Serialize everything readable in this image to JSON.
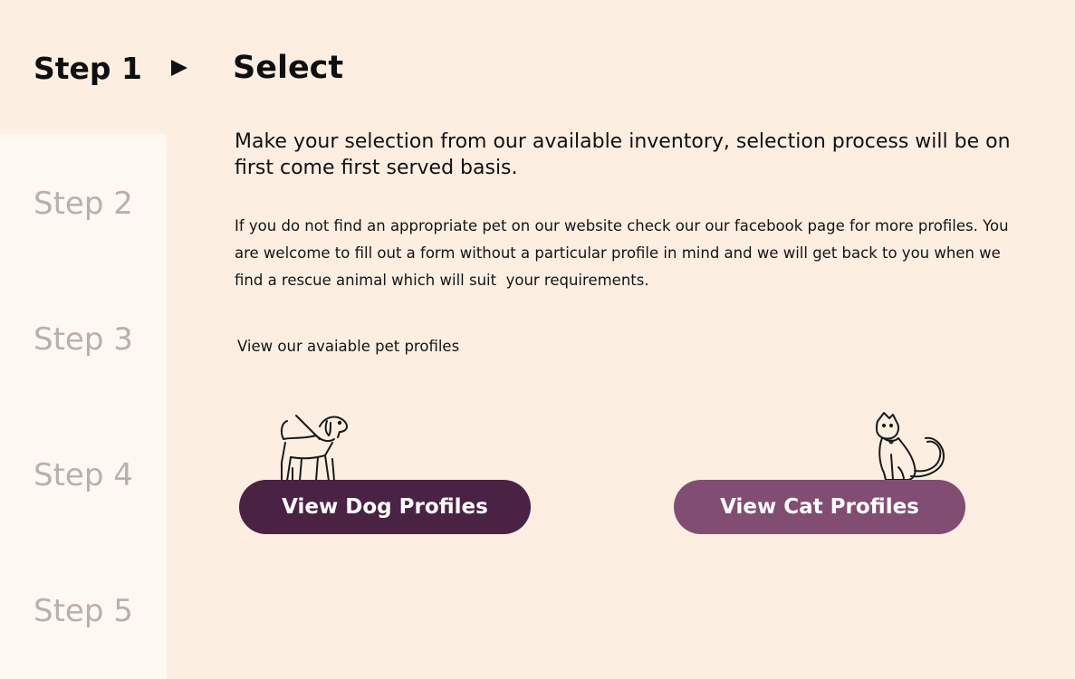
{
  "colors": {
    "page_background": "#fdeee2",
    "sidebar_background": "#fef7f2",
    "active_step_text": "#0f0f0f",
    "inactive_step_text": "#b5b1ae",
    "dog_button": "#4a2244",
    "cat_button": "#824d72",
    "button_text": "#ffffff"
  },
  "steps": [
    {
      "label": "Step 1",
      "active": true
    },
    {
      "label": "Step 2",
      "active": false
    },
    {
      "label": "Step 3",
      "active": false
    },
    {
      "label": "Step 4",
      "active": false
    },
    {
      "label": "Step 5",
      "active": false
    }
  ],
  "arrow_icon": "play-arrow-icon",
  "section": {
    "title": "Select",
    "lead": "Make your selection from our available inventory, selection process will be on first come first served basis.",
    "description": "If you do not find an appropriate pet on our website check our our facebook page for more profiles. You are welcome to fill out a form without a particular profile in mind and we will get back to you when we find a rescue animal which will suit  your requirements.",
    "profiles_label": "View our avaiable pet profiles"
  },
  "buttons": {
    "dog": {
      "label": "View Dog Profiles",
      "icon": "dog-on-leash-icon"
    },
    "cat": {
      "label": "View Cat Profiles",
      "icon": "sitting-cat-icon"
    }
  }
}
